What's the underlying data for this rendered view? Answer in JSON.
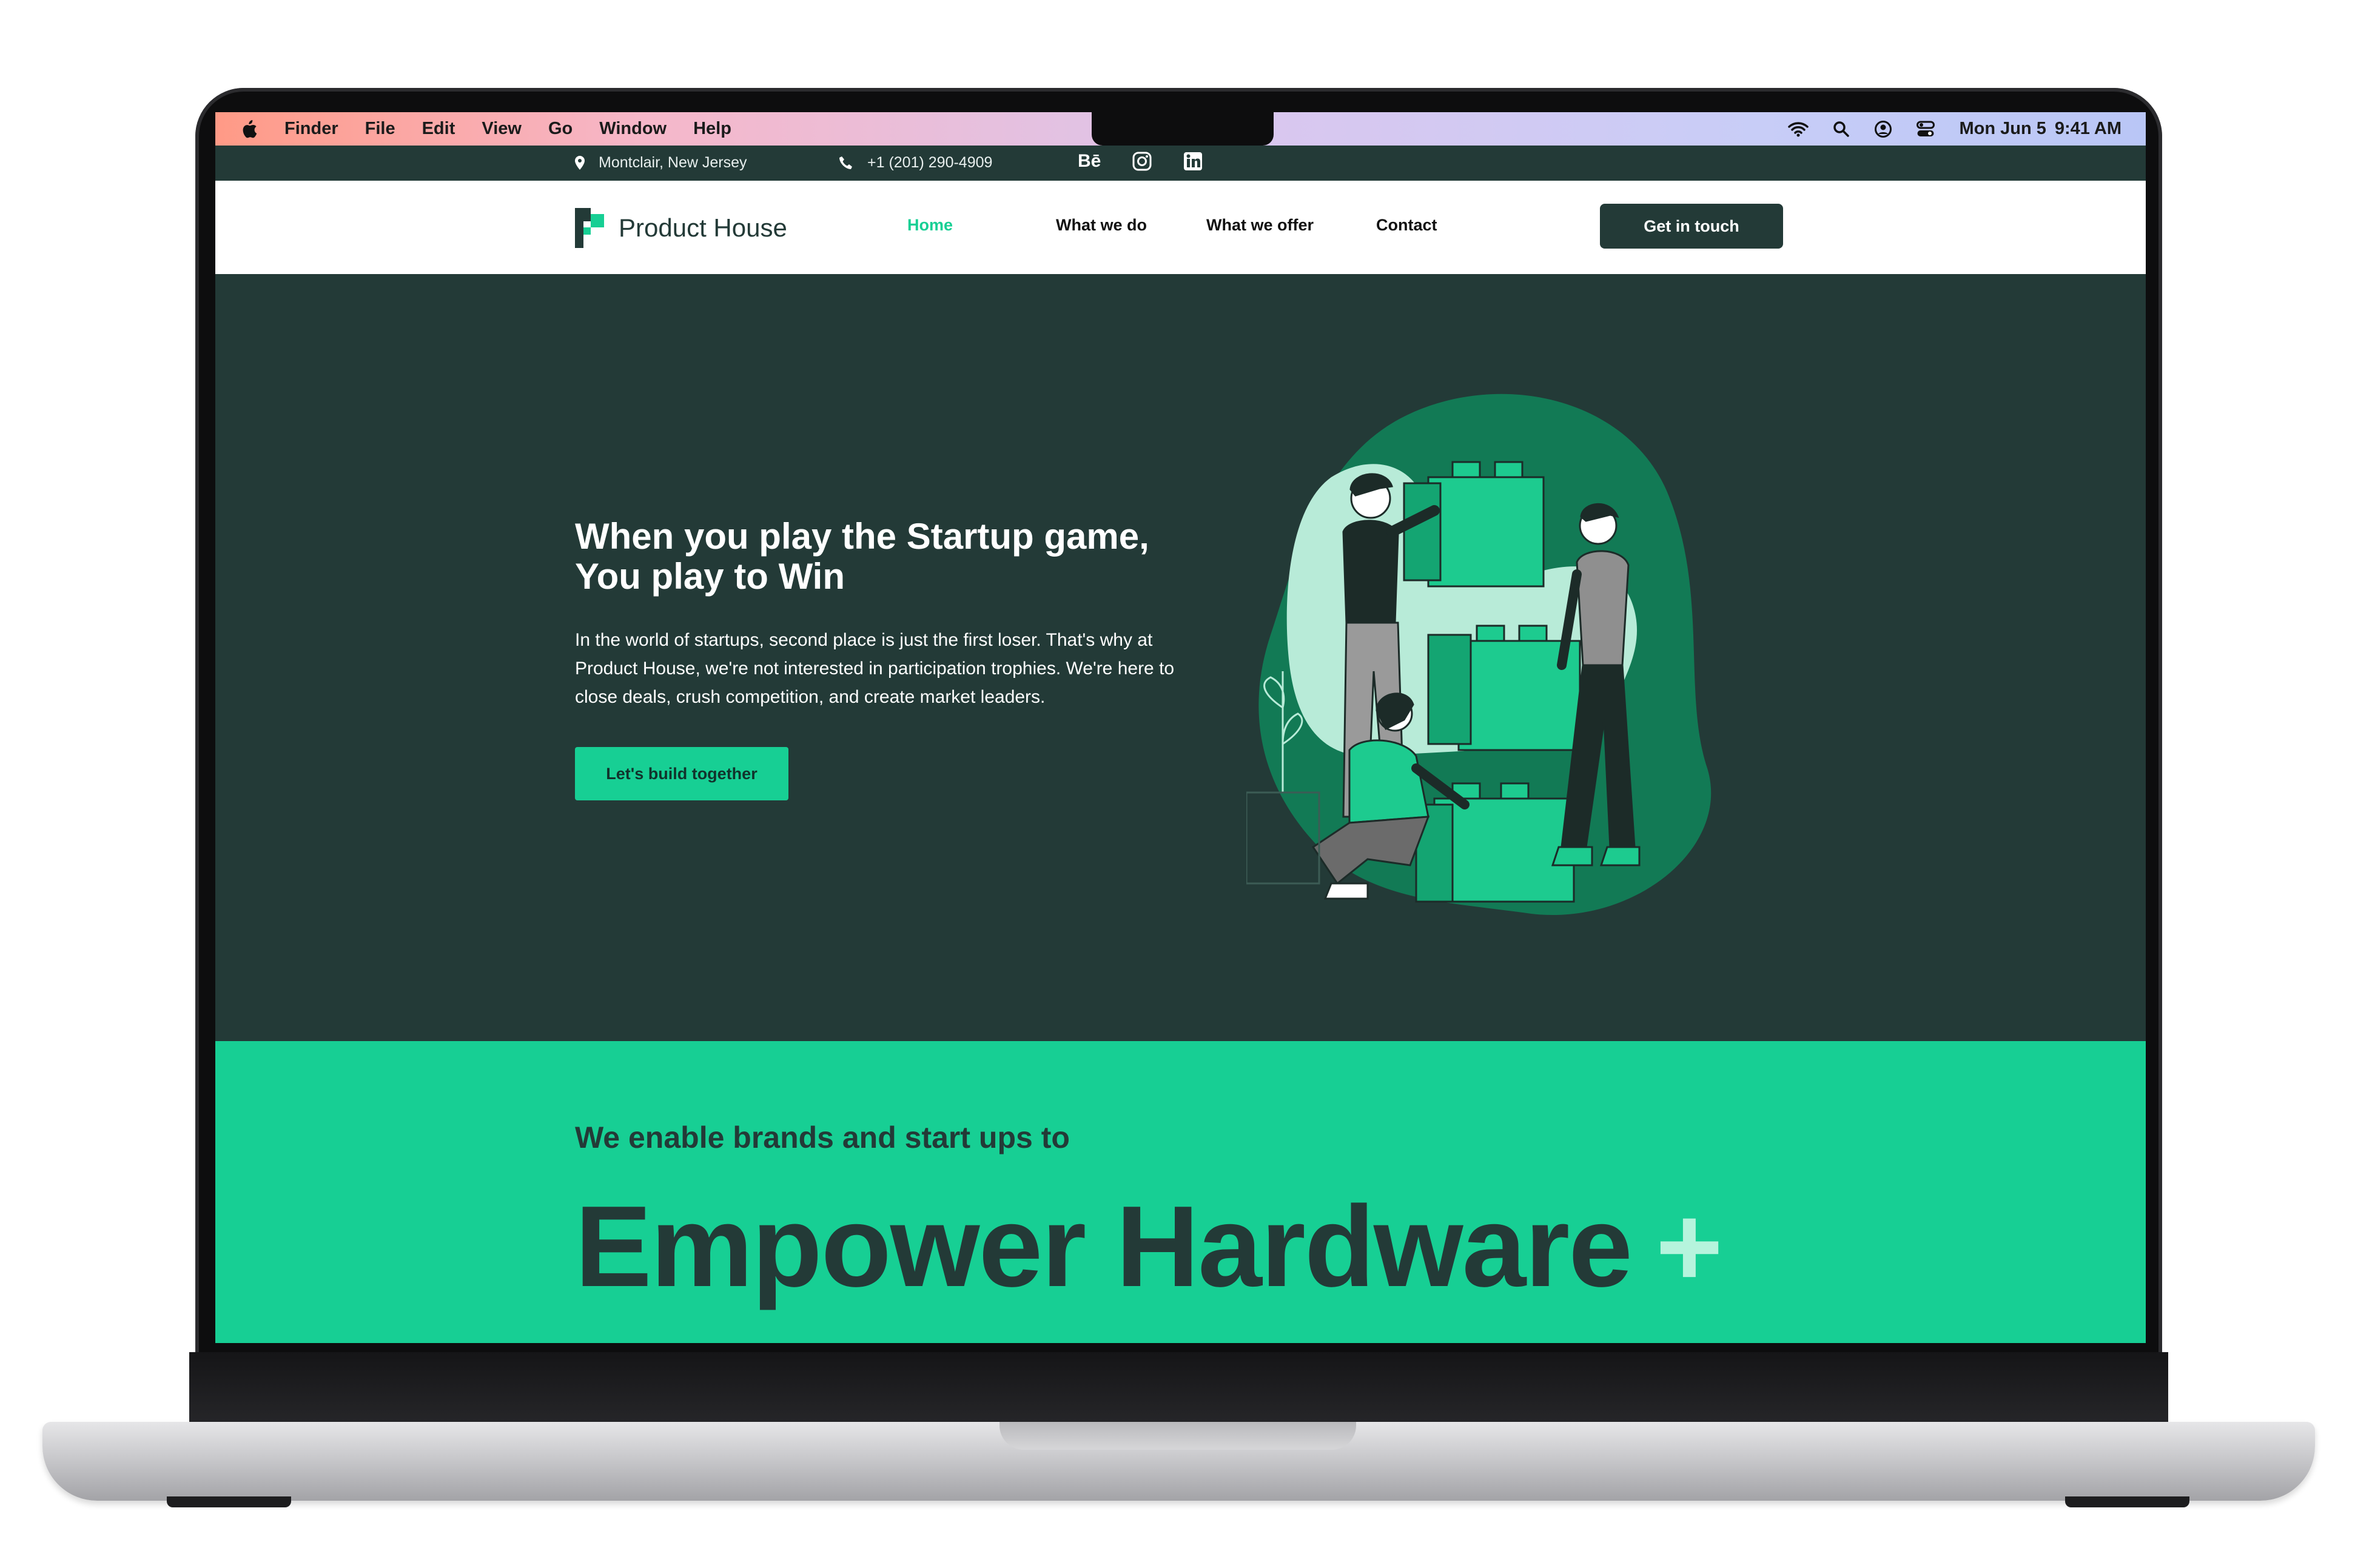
{
  "menubar": {
    "items": [
      "Finder",
      "File",
      "Edit",
      "View",
      "Go",
      "Window",
      "Help"
    ],
    "date": "Mon Jun 5",
    "time": "9:41 AM"
  },
  "topbar": {
    "location": "Montclair, New Jersey",
    "phone": "+1 (201) 290-4909",
    "social": {
      "behance": "Bē"
    }
  },
  "nav": {
    "brand": "Product House",
    "links": [
      "Home",
      "What we do",
      "What we offer",
      "Contact"
    ],
    "active": "Home",
    "cta": "Get in touch"
  },
  "hero": {
    "title_line1": "When you play the Startup game,",
    "title_line2": "You play to Win",
    "body": "In the world of startups, second place is just the first loser. That's why at Product House, we're not interested in participation trophies. We're here to close deals, crush competition, and create market leaders.",
    "button": "Let's build together"
  },
  "band": {
    "subtitle": "We enable brands and start ups to",
    "headline": "Empower Hardware",
    "plus": "+"
  },
  "colors": {
    "dark": "#233a37",
    "accent": "#17cf94",
    "accent_light": "#b6f4dd"
  }
}
